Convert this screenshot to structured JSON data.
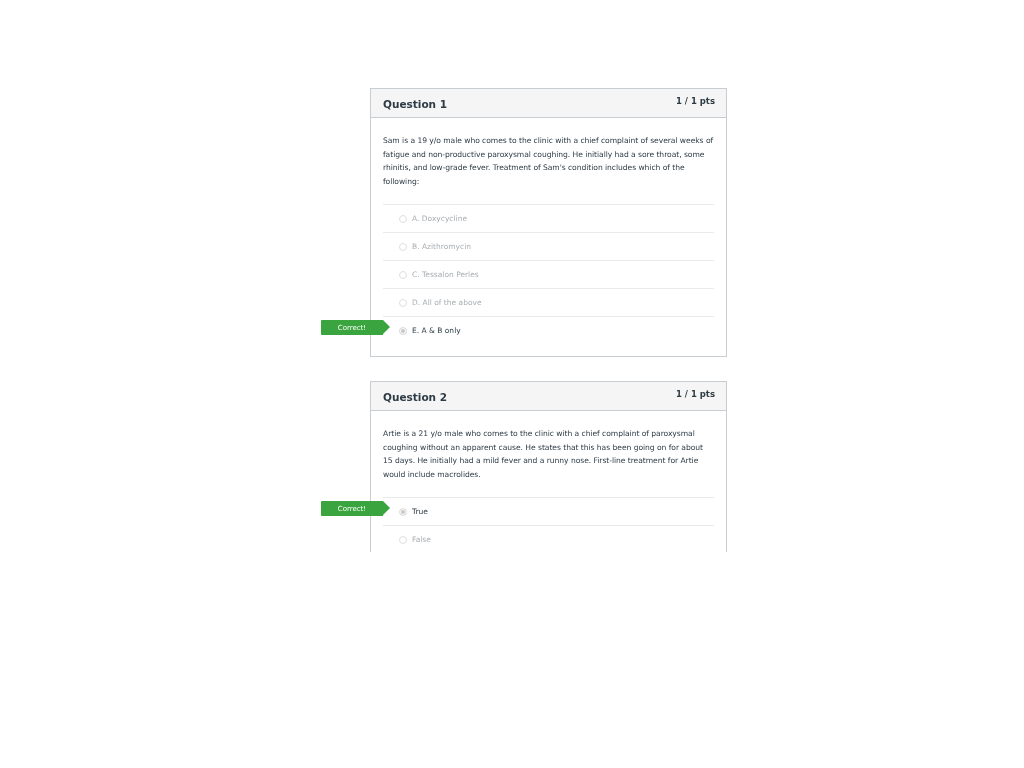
{
  "questions": [
    {
      "title": "Question 1",
      "points": "1 / 1 pts",
      "text": "Sam is a 19 y/o male who comes to the clinic with a chief complaint of several weeks of fatigue and non-productive paroxysmal coughing. He initially had a sore throat, some rhinitis, and low-grade fever. Treatment of Sam's condition includes which of the following:",
      "answers": [
        {
          "label": "A. Doxycycline",
          "selected": false
        },
        {
          "label": "B. Azithromycin",
          "selected": false
        },
        {
          "label": "C. Tessalon Perles",
          "selected": false
        },
        {
          "label": "D. All of the above",
          "selected": false
        },
        {
          "label": "E. A & B only",
          "selected": true,
          "flag": "Correct!"
        }
      ]
    },
    {
      "title": "Question 2",
      "points": "1 / 1 pts",
      "text": "Artie is a 21 y/o male who comes to the clinic with a chief complaint of paroxysmal coughing without an apparent cause. He states that this has been going on for about 15 days. He initially had a mild fever and a runny nose. First-line treatment for Artie would include macrolides.",
      "answers": [
        {
          "label": "True",
          "selected": true,
          "flag": "Correct!"
        },
        {
          "label": "False",
          "selected": false
        }
      ]
    }
  ]
}
